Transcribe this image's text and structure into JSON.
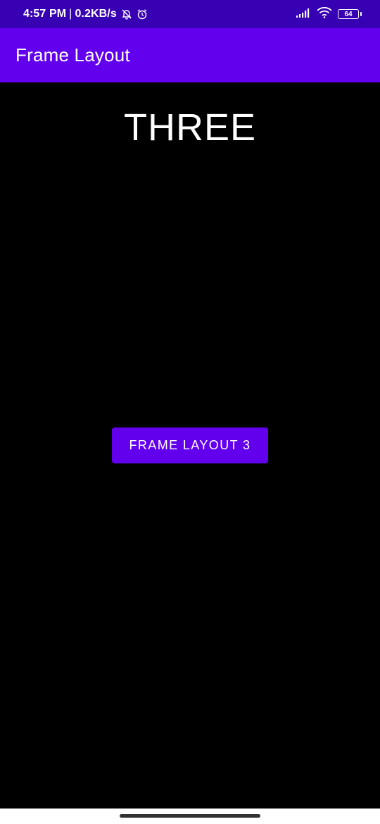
{
  "status_bar": {
    "time": "4:57 PM",
    "separator": "|",
    "network_speed": "0.2KB/s",
    "left_icons": [
      "mute-bell-icon",
      "alarm-clock-icon"
    ],
    "right_icons": [
      "cellular-signal-icon",
      "wifi-icon",
      "battery-icon"
    ],
    "battery_level": "64",
    "background": "#3700b3"
  },
  "app_bar": {
    "title": "Frame Layout",
    "background": "#6200ee"
  },
  "content": {
    "heading": "THREE",
    "button_label": "FRAME LAYOUT 3",
    "background": "#000000",
    "accent": "#6200ee"
  }
}
